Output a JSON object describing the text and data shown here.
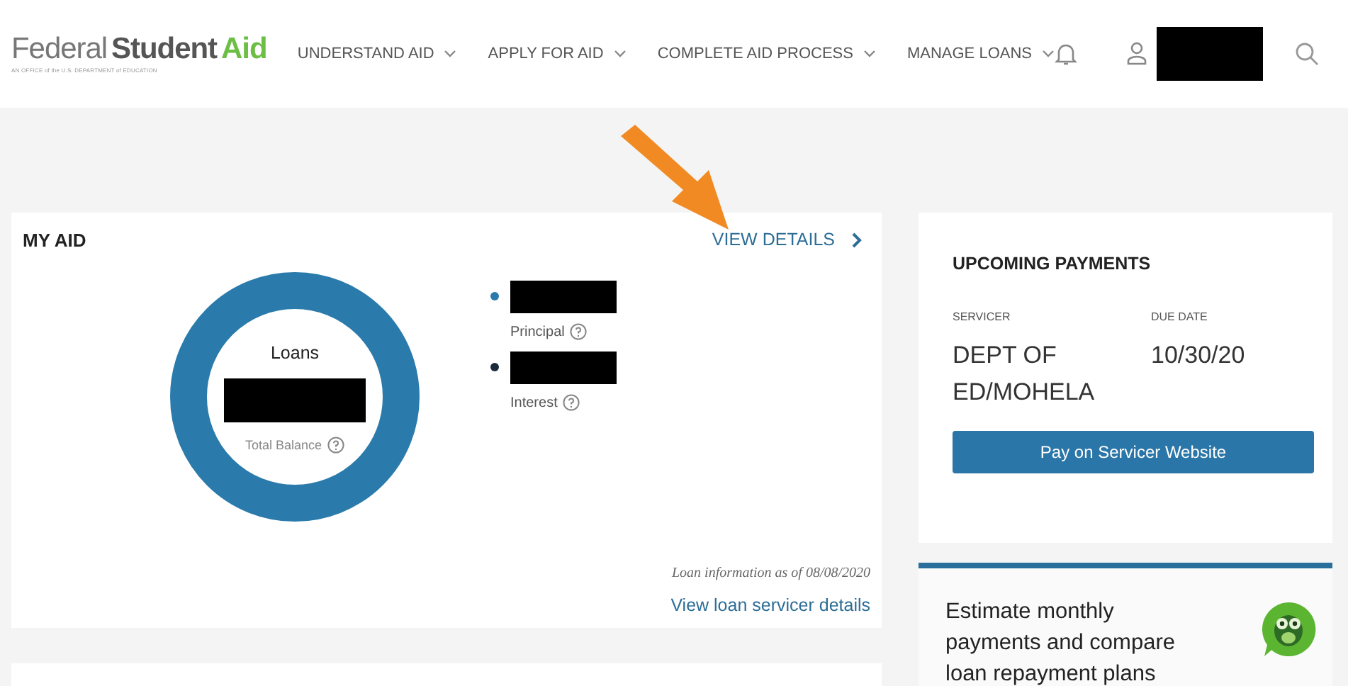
{
  "header": {
    "logo": {
      "parts": [
        "Federal",
        "Student",
        "Aid"
      ],
      "tagline": "AN OFFICE of the U.S. DEPARTMENT of EDUCATION"
    },
    "nav": [
      {
        "label": "UNDERSTAND AID"
      },
      {
        "label": "APPLY FOR AID"
      },
      {
        "label": "COMPLETE AID PROCESS"
      },
      {
        "label": "MANAGE LOANS"
      }
    ]
  },
  "my_aid": {
    "title": "MY AID",
    "view_details": "VIEW DETAILS",
    "donut": {
      "label": "Loans",
      "caption": "Total Balance"
    },
    "legend": [
      {
        "label": "Principal",
        "color": "#2a7bab"
      },
      {
        "label": "Interest",
        "color": "#1b2a3a"
      }
    ],
    "as_of": "Loan information as of 08/08/2020",
    "servicer_link": "View loan servicer details"
  },
  "upcoming": {
    "title": "UPCOMING PAYMENTS",
    "columns": [
      {
        "label": "SERVICER",
        "value": "DEPT OF ED/MOHELA"
      },
      {
        "label": "DUE DATE",
        "value": "10/30/20"
      }
    ],
    "button": "Pay on Servicer Website"
  },
  "estimate": {
    "text": "Estimate monthly payments and compare loan repayment plans"
  }
}
